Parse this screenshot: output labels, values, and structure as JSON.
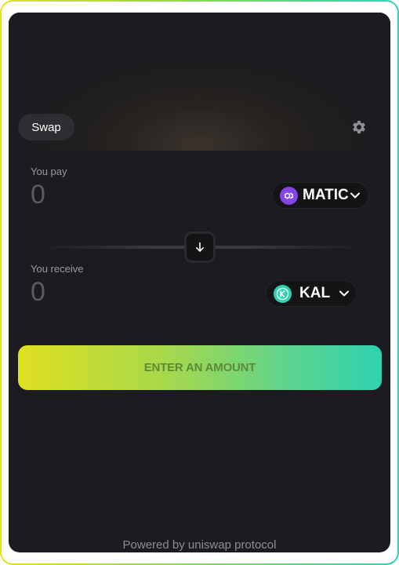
{
  "header": {
    "swap_label": "Swap"
  },
  "pay": {
    "label": "You pay",
    "amount": "0",
    "token": "MATIC",
    "token_icon": "polygon-icon",
    "token_color": "#8247e5"
  },
  "receive": {
    "label": "You receive",
    "amount": "0",
    "token": "KAL",
    "token_icon": "kal-icon",
    "token_color": "#2ed2b2"
  },
  "action": {
    "label": "ENTER AN AMOUNT"
  },
  "footer": {
    "powered_by": "Powered by uniswap protocol"
  }
}
